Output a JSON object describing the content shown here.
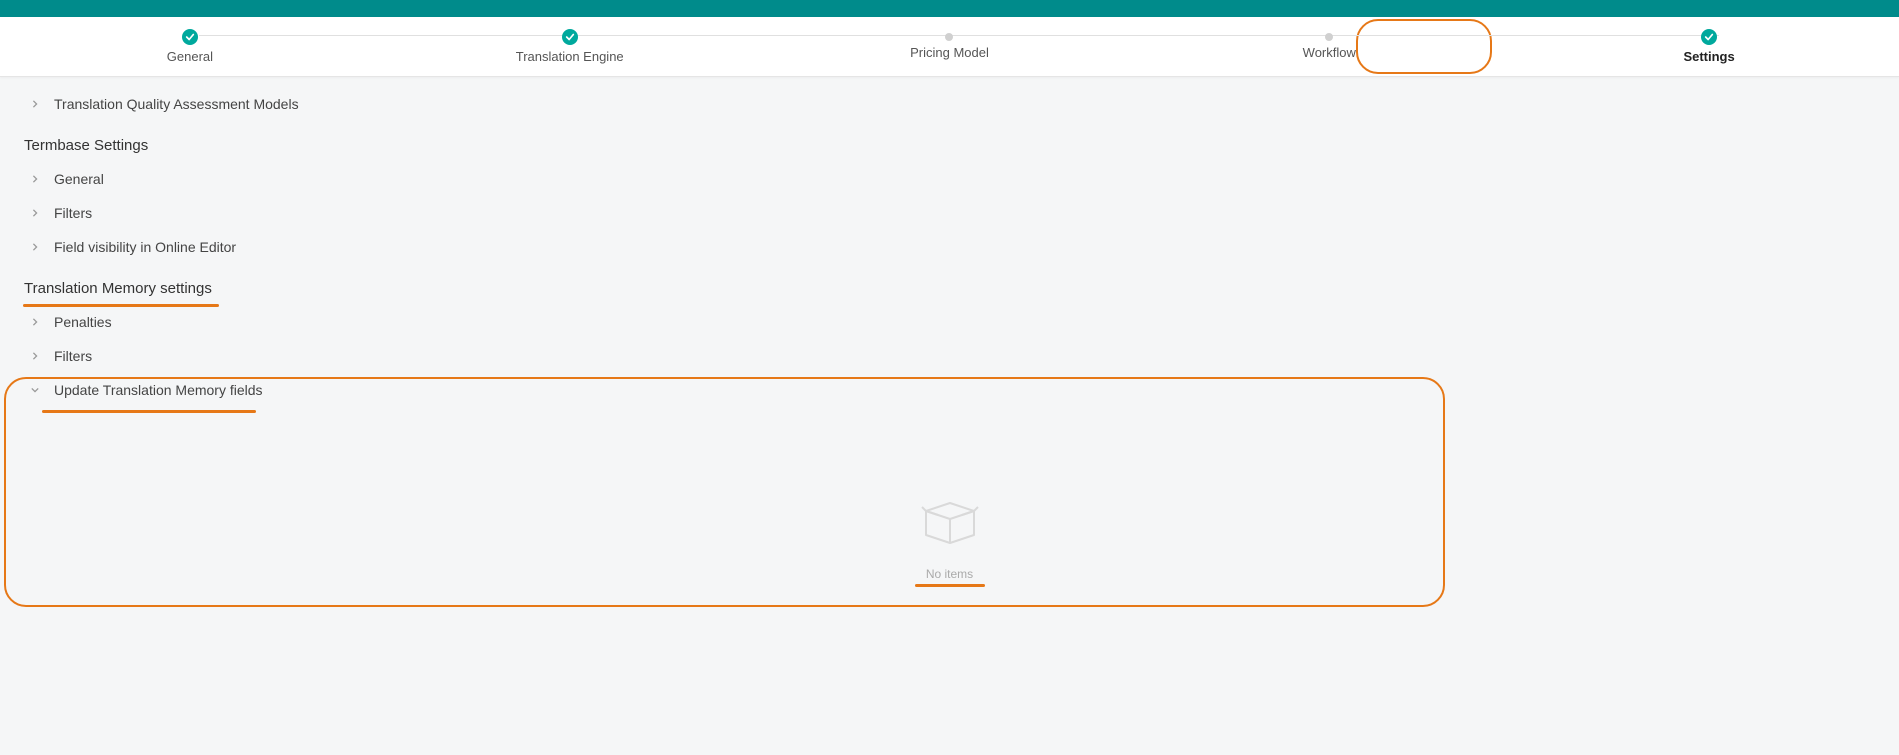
{
  "stepper": {
    "steps": [
      {
        "label": "General",
        "state": "done"
      },
      {
        "label": "Translation Engine",
        "state": "done"
      },
      {
        "label": "Pricing Model",
        "state": "pending"
      },
      {
        "label": "Workflow",
        "state": "pending"
      },
      {
        "label": "Settings",
        "state": "done",
        "active": true
      }
    ]
  },
  "tree": {
    "top_item": "Translation Quality Assessment Models",
    "section_termbase": {
      "heading": "Termbase Settings",
      "items": [
        "General",
        "Filters",
        "Field visibility in Online Editor"
      ]
    },
    "section_tm": {
      "heading": "Translation Memory settings",
      "items": [
        "Penalties",
        "Filters",
        "Update Translation Memory fields"
      ]
    }
  },
  "empty": {
    "message": "No items"
  }
}
